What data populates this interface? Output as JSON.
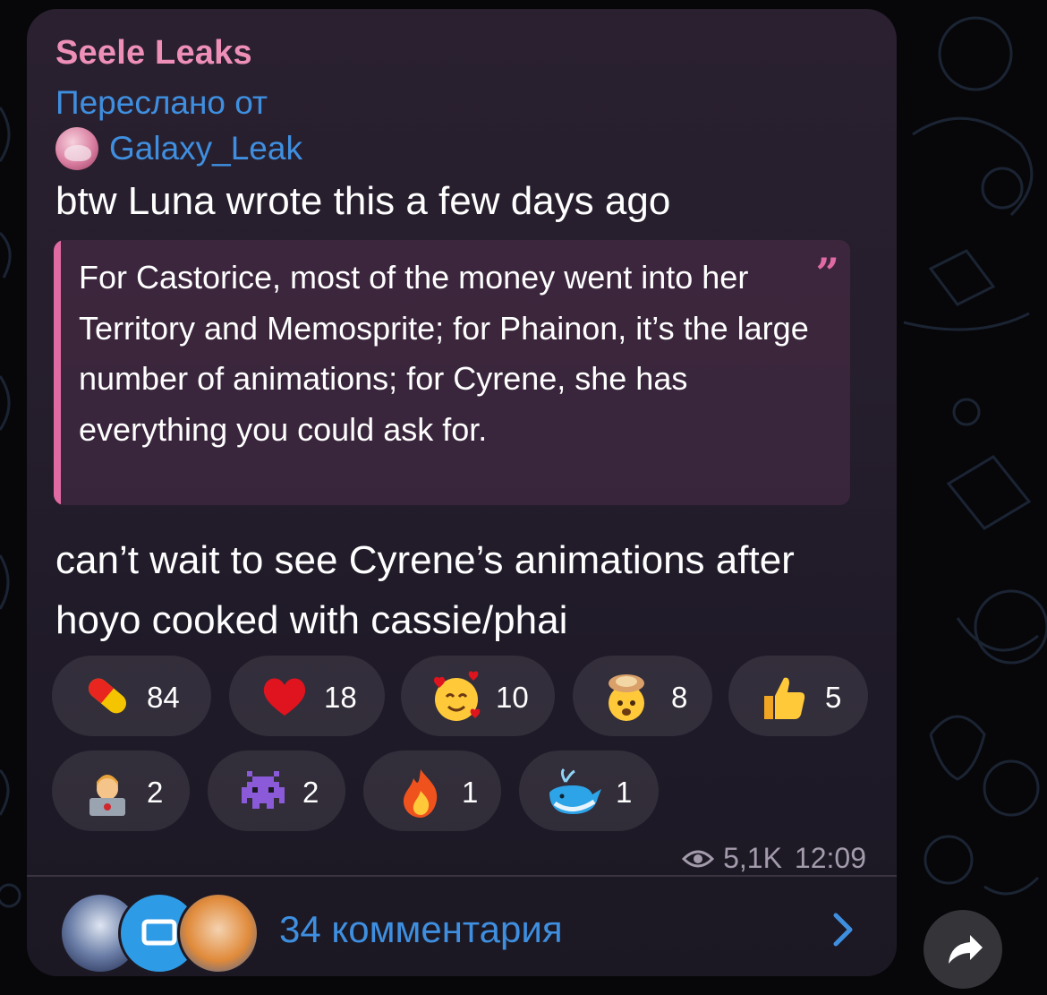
{
  "message": {
    "channel_name": "Seele Leaks",
    "forwarded_label": "Переслано от",
    "forwarded_source": "Galaxy_Leak",
    "text_intro": "btw Luna wrote this a few days ago",
    "quote": "For Castorice, most of the money went into her Territory and Memosprite; for Phainon, it’s the large number of animations; for Cyrene, she has everything you could ask for.",
    "text_outro": "can’t wait to see Cyrene’s animations after hoyo cooked with cassie/phai",
    "views": "5,1K",
    "time": "12:09"
  },
  "reactions": [
    {
      "emoji": "pill-icon",
      "count": "84"
    },
    {
      "emoji": "red-heart-icon",
      "count": "18"
    },
    {
      "emoji": "smiling-face-with-hearts-icon",
      "count": "10"
    },
    {
      "emoji": "exploding-head-icon",
      "count": "8"
    },
    {
      "emoji": "thumbs-up-icon",
      "count": "5"
    },
    {
      "emoji": "technologist-icon",
      "count": "2"
    },
    {
      "emoji": "alien-monster-icon",
      "count": "2"
    },
    {
      "emoji": "fire-icon",
      "count": "1"
    },
    {
      "emoji": "whale-icon",
      "count": "1"
    }
  ],
  "comments": {
    "label": "34 комментария"
  },
  "colors": {
    "channel_name": "#ee8fb8",
    "link_blue": "#3f8fe0",
    "quote_accent": "#e06aa3",
    "bubble": "#261e2c",
    "background": "#07070a"
  }
}
